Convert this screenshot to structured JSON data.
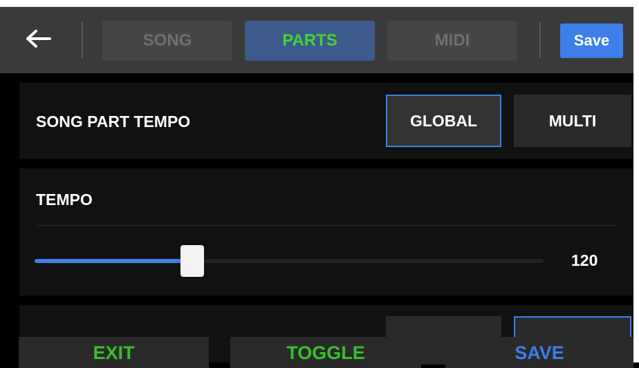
{
  "header": {
    "tabs": [
      {
        "label": "SONG"
      },
      {
        "label": "PARTS"
      },
      {
        "label": "MIDI"
      }
    ],
    "active_tab": "PARTS",
    "save_label": "Save"
  },
  "song_part_tempo": {
    "label": "SONG PART TEMPO",
    "options": [
      "GLOBAL",
      "MULTI"
    ],
    "selected": "GLOBAL"
  },
  "tempo": {
    "label": "TEMPO",
    "value": "120",
    "slider_fraction": 0.31
  },
  "footer": {
    "exit_label": "EXIT",
    "toggle_label": "TOGGLE",
    "save_label": "SAVE"
  },
  "colors": {
    "accent_blue": "#3d7ee8",
    "accent_green": "#36c22c",
    "tab_active_bg": "#3d5a8c"
  },
  "icons": {
    "back": "arrow-left-icon"
  }
}
